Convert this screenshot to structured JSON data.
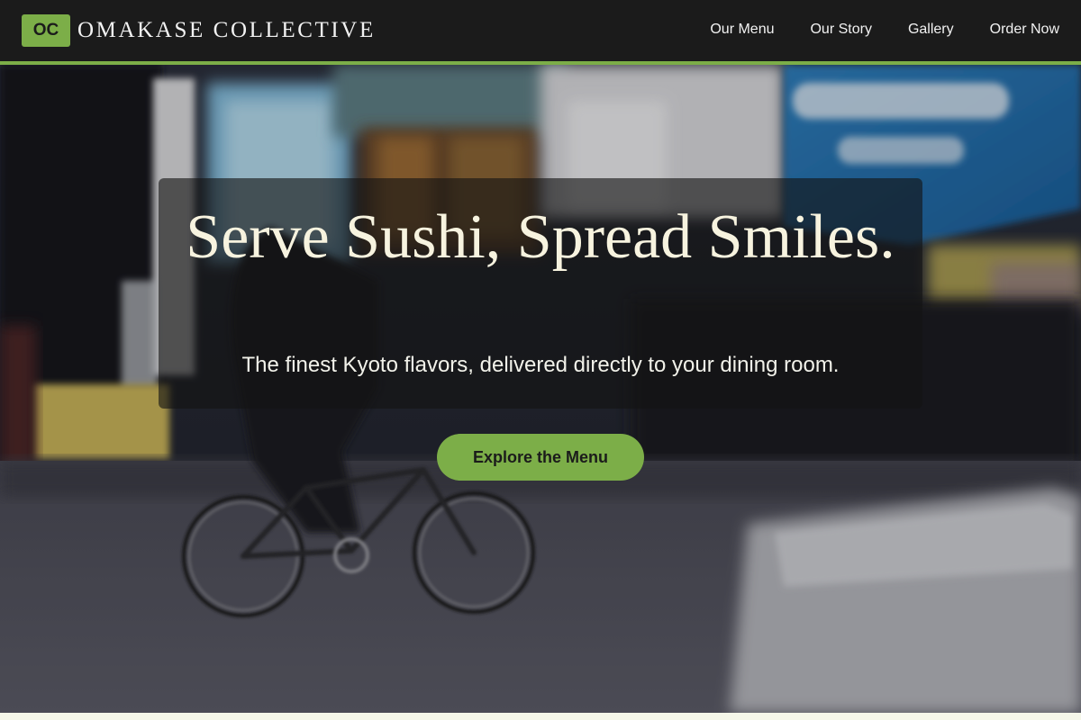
{
  "brand": {
    "logo_initials": "OC",
    "name": "OMAKASE COLLECTIVE"
  },
  "nav": {
    "links": [
      {
        "label": "Our Menu"
      },
      {
        "label": "Our Story"
      },
      {
        "label": "Gallery"
      },
      {
        "label": "Order Now"
      }
    ]
  },
  "hero": {
    "title": "Serve Sushi, Spread Smiles.",
    "subtitle": "The finest Kyoto flavors, delivered directly to your dining room.",
    "cta_label": "Explore the Menu",
    "background_image": "blurred night city street with cyclist"
  },
  "colors": {
    "accent": "#7cae48",
    "nav_background": "#1b1b1b",
    "title_text": "#f7f3df",
    "page_background": "#f5f7e9"
  }
}
